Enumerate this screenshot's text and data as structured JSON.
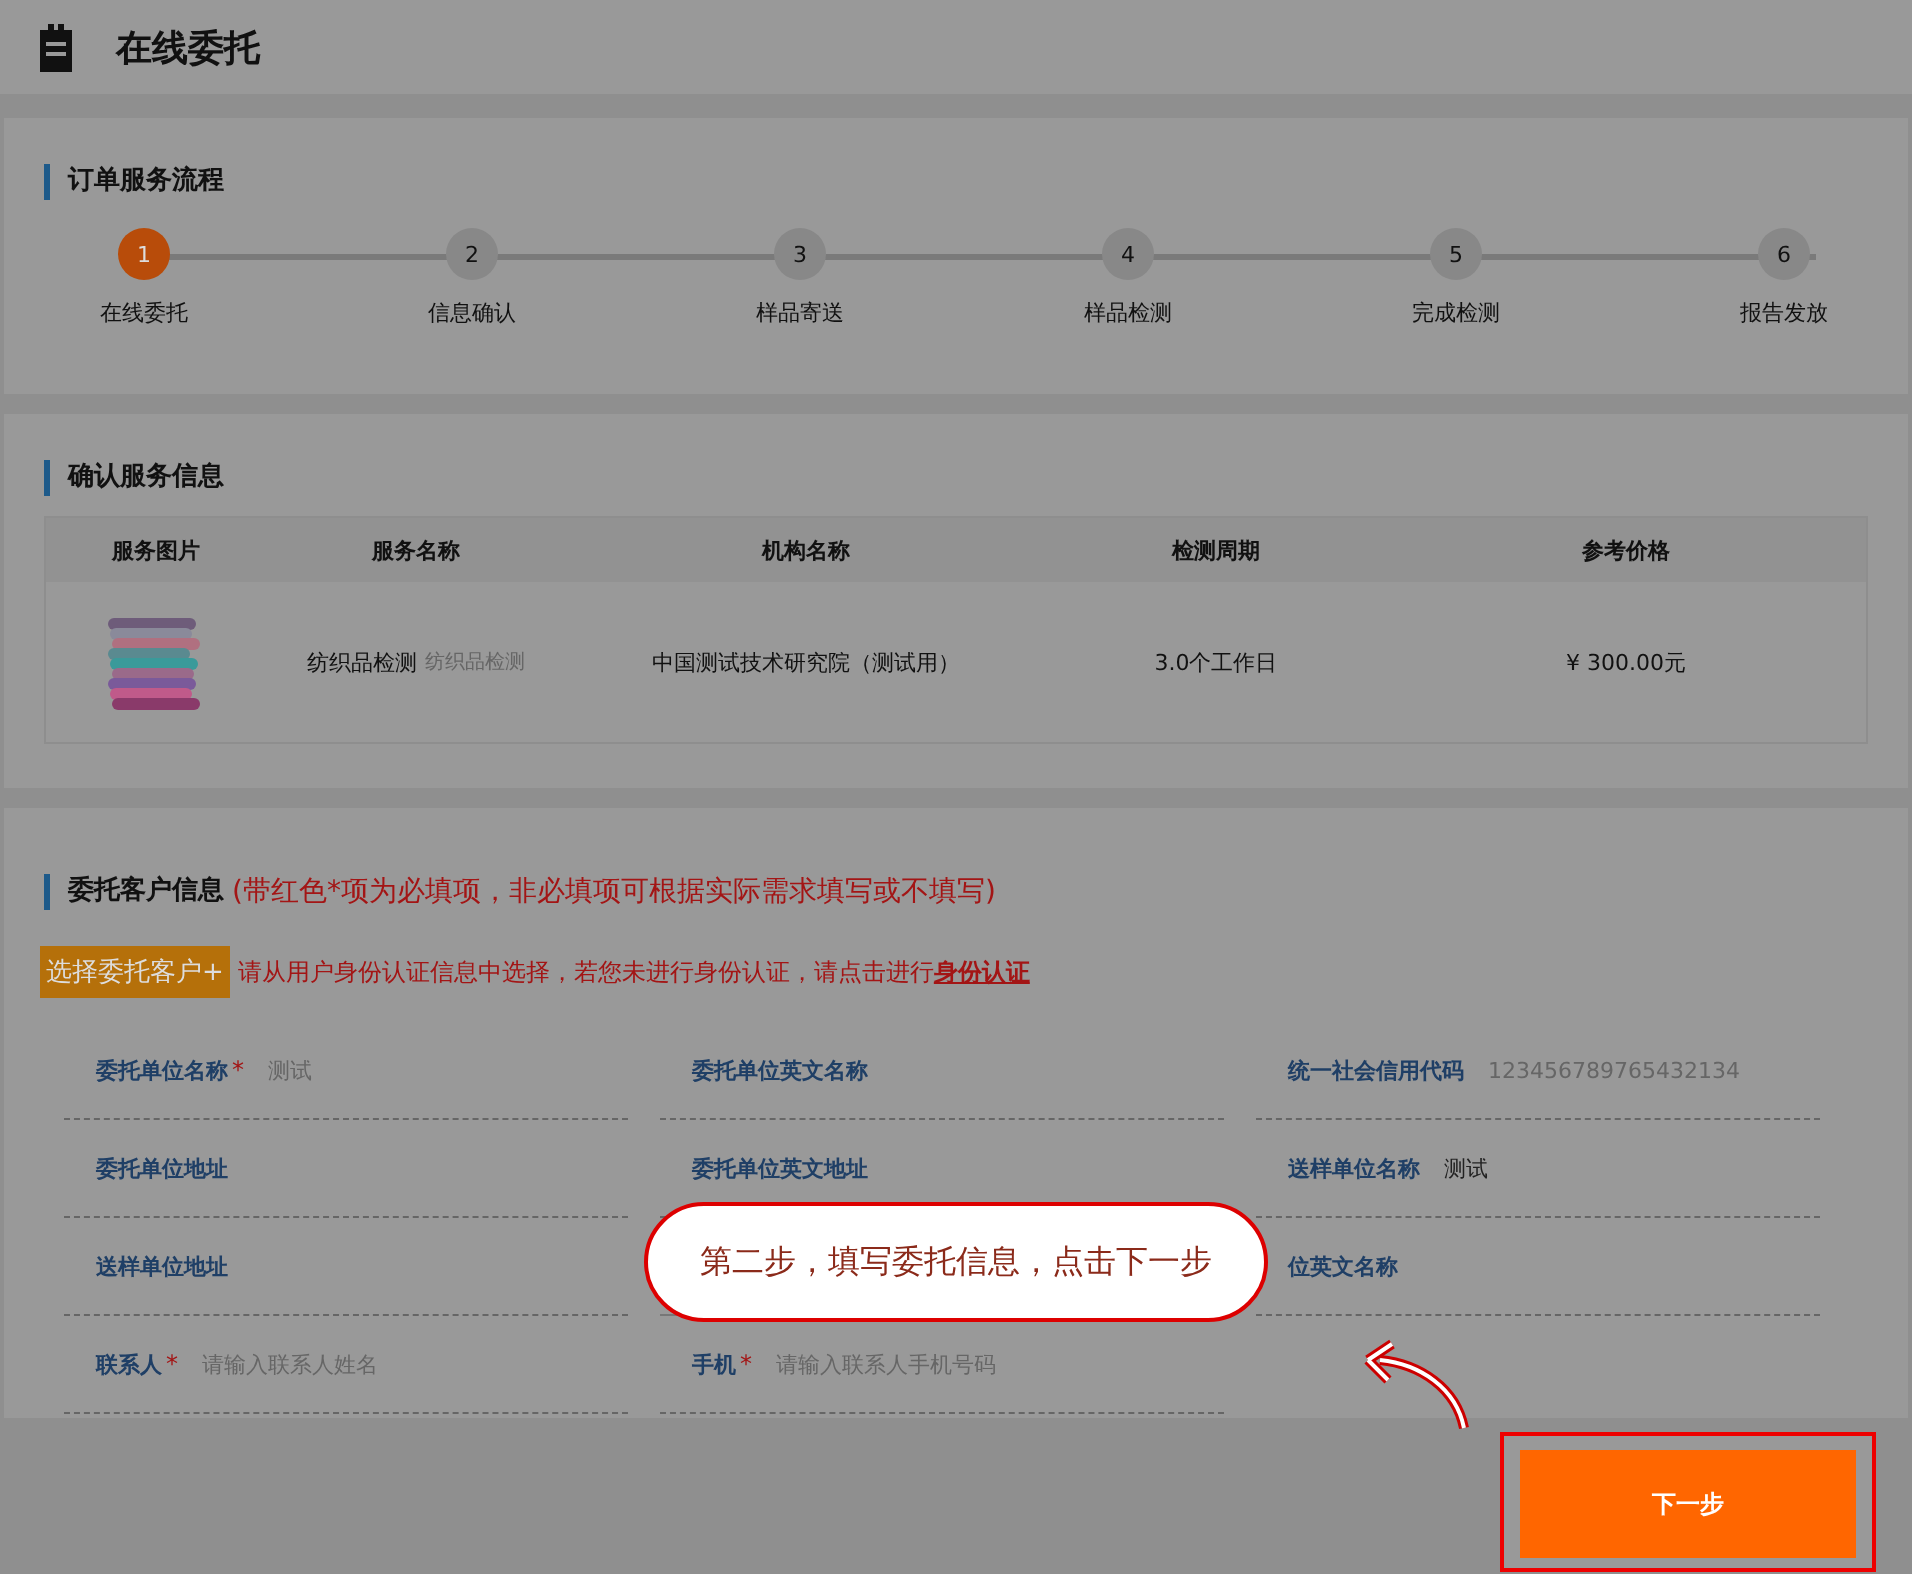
{
  "header": {
    "title": "在线委托"
  },
  "process": {
    "title": "订单服务流程",
    "steps": [
      {
        "number": "1",
        "label": "在线委托",
        "selected": true
      },
      {
        "number": "2",
        "label": "信息确认",
        "selected": false
      },
      {
        "number": "3",
        "label": "样品寄送",
        "selected": false
      },
      {
        "number": "4",
        "label": "样品检测",
        "selected": false
      },
      {
        "number": "5",
        "label": "完成检测",
        "selected": false
      },
      {
        "number": "6",
        "label": "报告发放",
        "selected": false
      }
    ]
  },
  "service": {
    "title": "确认服务信息",
    "columns": [
      "服务图片",
      "服务名称",
      "机构名称",
      "检测周期",
      "参考价格"
    ],
    "rows": [
      {
        "name": "纺织品检测",
        "subname": "纺织品检测",
        "agency": "中国测试技术研究院（测试用）",
        "period": "3.0个工作日",
        "price": "¥ 300.00元"
      }
    ]
  },
  "client": {
    "title": "委托客户信息",
    "note": "(带红色*项为必填项，非必填项可根据实际需求填写或不填写)",
    "select_button": "选择委托客户+",
    "hint": "请从用户身份认证信息中选择，若您未进行身份认证，请点击进行",
    "hint_link": "身份认证",
    "fields": [
      {
        "kind": "field",
        "label": "委托单位名称",
        "required_mark": "*",
        "placeholder": "测试"
      },
      {
        "kind": "field",
        "label": "委托单位英文名称"
      },
      {
        "kind": "field",
        "label": "统一社会信用代码",
        "placeholder": "123456789765432134"
      },
      {
        "kind": "field",
        "label": "委托单位地址"
      },
      {
        "kind": "field",
        "label": "委托单位英文地址"
      },
      {
        "kind": "field",
        "label": "送样单位名称",
        "value": "测试"
      },
      {
        "kind": "field",
        "label": "送样单位地址"
      },
      {
        "kind": "covered"
      },
      {
        "kind": "field",
        "label": "位英文名称"
      },
      {
        "kind": "field",
        "label": "联系人",
        "required_mark": "*",
        "placeholder": "请输入联系人姓名"
      },
      {
        "kind": "field",
        "label": "手机",
        "required_mark": "*",
        "placeholder": "请输入联系人手机号码"
      }
    ]
  },
  "tip": {
    "text": "第二步，填写委托信息，点击下一步"
  },
  "next_button": "下一步"
}
